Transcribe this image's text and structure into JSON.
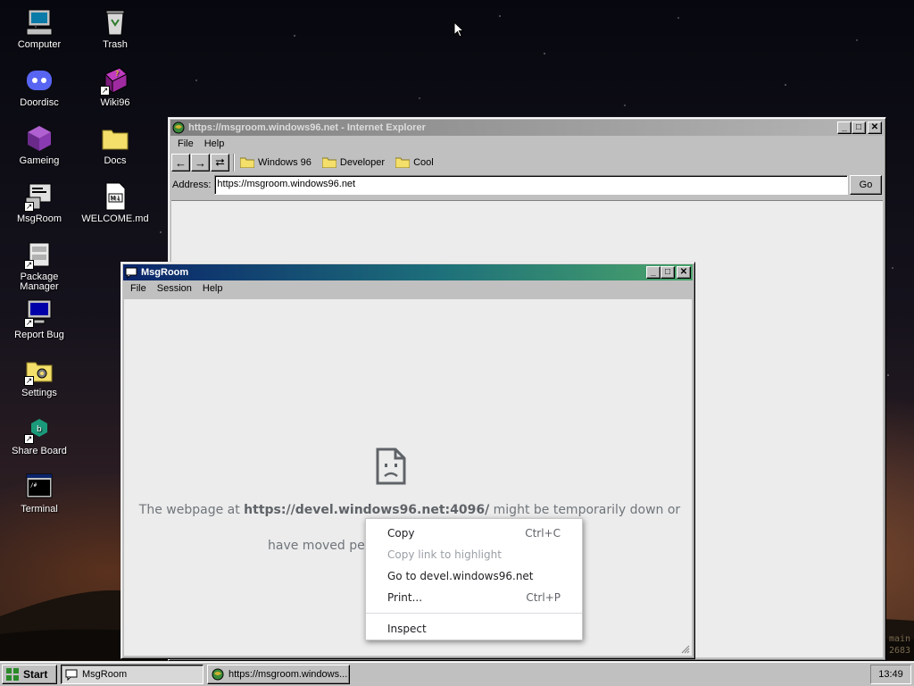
{
  "desktop": {
    "icons": [
      {
        "label": "Computer",
        "icon": "computer-icon"
      },
      {
        "label": "Trash",
        "icon": "trash-icon"
      },
      {
        "label": "Doordisc",
        "icon": "doordisc-icon"
      },
      {
        "label": "Wiki96",
        "icon": "wiki-book-icon"
      },
      {
        "label": "Gameing",
        "icon": "cube-icon"
      },
      {
        "label": "Docs",
        "icon": "folder-icon"
      },
      {
        "label": "MsgRoom",
        "icon": "msgroom-icon"
      },
      {
        "label": "WELCOME.md",
        "icon": "markdown-file-icon"
      },
      {
        "label": "Package Manager",
        "icon": "package-icon"
      },
      {
        "label": "Report Bug",
        "icon": "monitor-icon"
      },
      {
        "label": "Settings",
        "icon": "settings-folder-icon"
      },
      {
        "label": "Share Board",
        "icon": "share-board-icon"
      },
      {
        "label": "Terminal",
        "icon": "terminal-icon"
      }
    ]
  },
  "ie_window": {
    "title": "https://msgroom.windows96.net - Internet Explorer",
    "menu": [
      "File",
      "Help"
    ],
    "nav": {
      "back": "←",
      "forward": "→",
      "refresh": "⮂"
    },
    "favorites": [
      "Windows 96",
      "Developer",
      "Cool"
    ],
    "address_label": "Address:",
    "address_value": "https://msgroom.windows96.net",
    "go_label": "Go"
  },
  "msgroom_window": {
    "title": "MsgRoom",
    "menu": [
      "File",
      "Session",
      "Help"
    ],
    "error": {
      "prefix": "The webpage at ",
      "url": "https://devel.windows96.net:4096/",
      "suffix_line1": " might be temporarily down or it may",
      "line2_visible": "have moved perm"
    }
  },
  "context_menu": {
    "items": [
      {
        "label": "Copy",
        "shortcut": "Ctrl+C"
      },
      {
        "label": "Copy link to highlight",
        "shortcut": ""
      },
      {
        "label": "Go to devel.windows96.net",
        "shortcut": ""
      },
      {
        "label": "Print...",
        "shortcut": "Ctrl+P"
      },
      {
        "label": "Inspect",
        "shortcut": ""
      }
    ]
  },
  "taskbar": {
    "start_label": "Start",
    "tasks": [
      {
        "label": "MsgRoom"
      },
      {
        "label": "https://msgroom.windows..."
      }
    ],
    "clock": "13:49"
  },
  "corner_text": [
    "main",
    "2683"
  ]
}
